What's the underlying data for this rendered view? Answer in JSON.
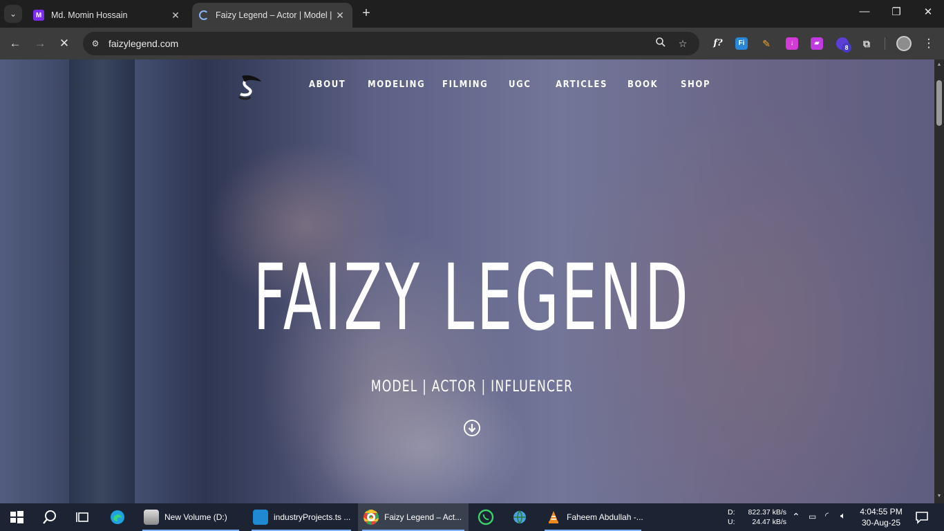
{
  "browser": {
    "tabs": [
      {
        "title": "Md. Momin Hossain",
        "favicon": "M",
        "active": false
      },
      {
        "title": "Faizy Legend – Actor | Model | I",
        "favicon": "loading-spinner",
        "active": true
      }
    ],
    "address": "faizylegend.com",
    "extension_badge": "8",
    "extension_fx": "f?",
    "extension_fi": "Fi"
  },
  "site": {
    "nav": [
      "ABOUT",
      "MODELING",
      "FILMING",
      "UGC",
      "ARTICLES",
      "BOOK",
      "SHOP"
    ],
    "hero_title": "FAIZY LEGEND",
    "hero_subtitle": "MODEL | ACTOR | INFLUENCER"
  },
  "taskbar": {
    "apps": [
      {
        "label": "New Volume (D:)",
        "icon": "drive-icon"
      },
      {
        "label": "industryProjects.ts ...",
        "icon": "vscode-icon"
      },
      {
        "label": "Faizy Legend – Act...",
        "icon": "chrome-icon",
        "active": true
      },
      {
        "label": "",
        "icon": "whatsapp-icon"
      },
      {
        "label": "",
        "icon": "network-globe-icon"
      },
      {
        "label": "Faheem Abdullah -...",
        "icon": "vlc-icon"
      }
    ],
    "net": {
      "d_label": "D:",
      "u_label": "U:",
      "down": "822.37 kB/s",
      "up": "24.47 kB/s"
    },
    "time": "4:04:55 PM",
    "date": "30-Aug-25"
  },
  "colors": {
    "accent": "#7fb3ff",
    "tab_m": "#7b2cf0"
  }
}
